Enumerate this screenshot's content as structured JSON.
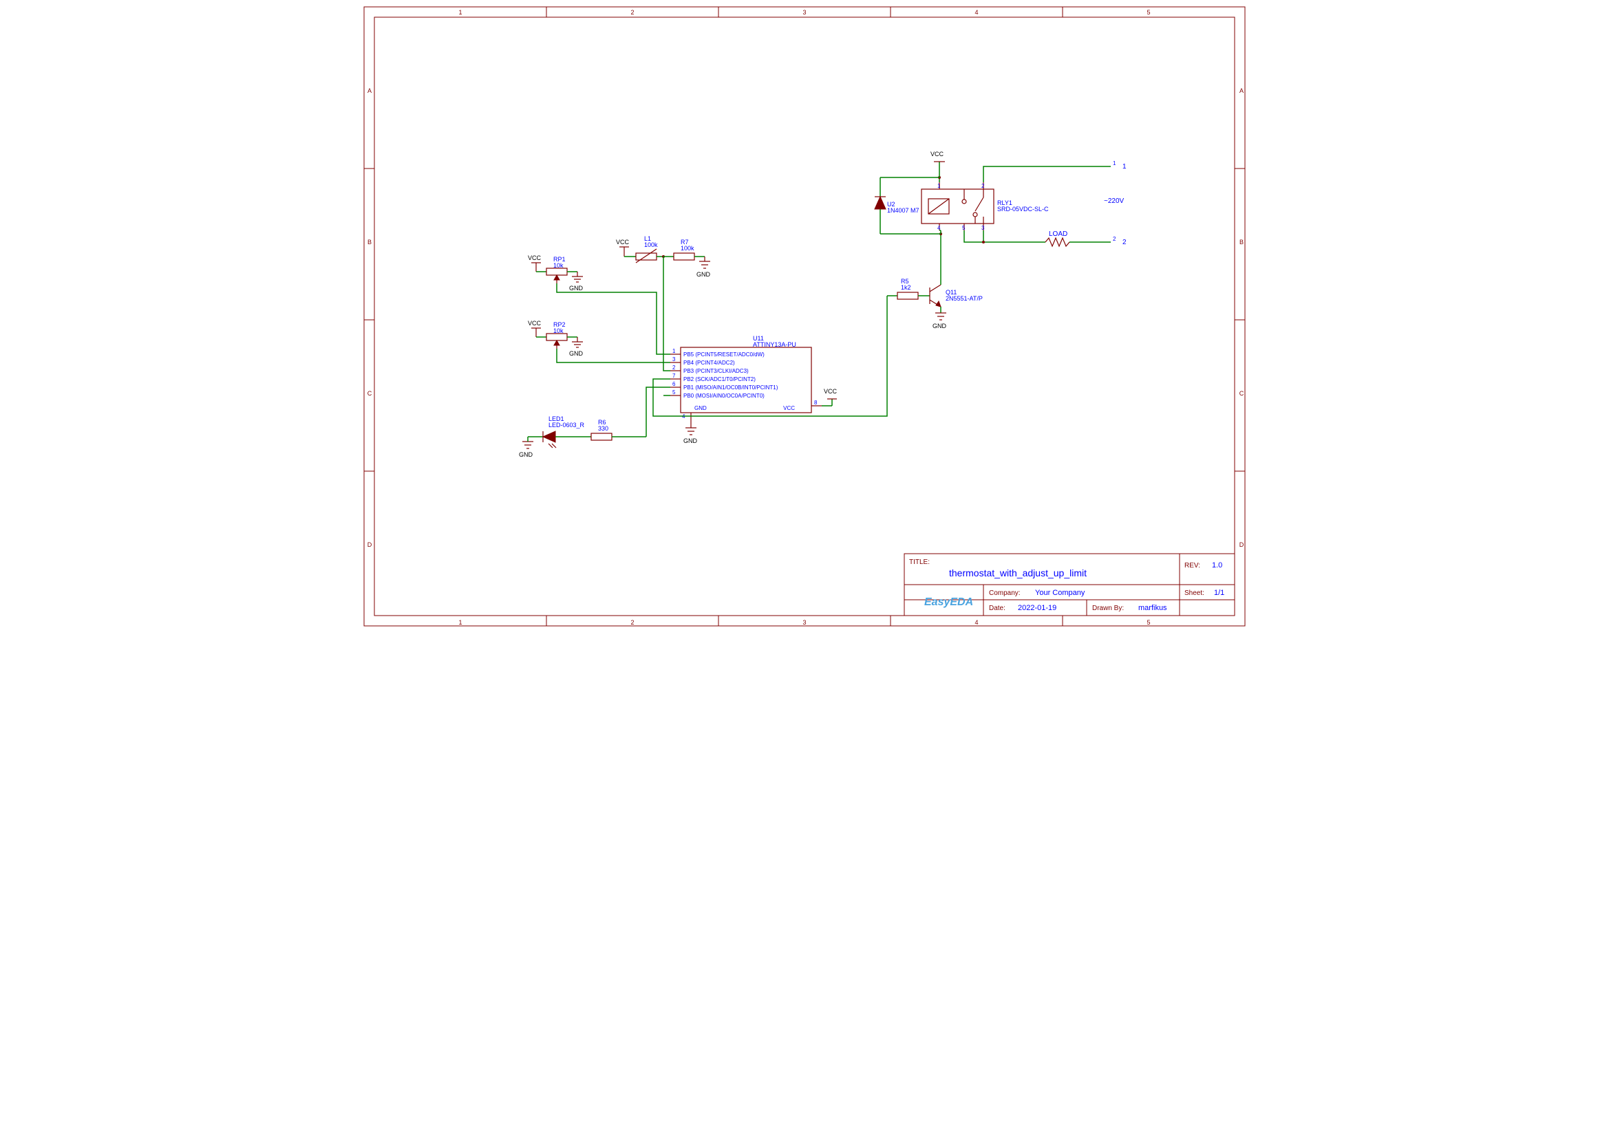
{
  "frame": {
    "cols": [
      "1",
      "2",
      "3",
      "4",
      "5"
    ],
    "rows": [
      "A",
      "B",
      "C",
      "D"
    ]
  },
  "titleblock": {
    "title_lbl": "TITLE:",
    "title": "thermostat_with_adjust_up_limit",
    "rev_lbl": "REV:",
    "rev": "1.0",
    "company_lbl": "Company:",
    "company": "Your Company",
    "sheet_lbl": "Sheet:",
    "sheet": "1/1",
    "date_lbl": "Date:",
    "date": "2022-01-19",
    "drawn_lbl": "Drawn By:",
    "drawn": "marfikus",
    "logo": "EasyEDA"
  },
  "power": {
    "vcc": "VCC",
    "gnd": "GND"
  },
  "annot": {
    "mains": "~220V",
    "load": "LOAD"
  },
  "conn": {
    "p1_pin": "1",
    "p1_lbl": "1",
    "p2_pin": "2",
    "p2_lbl": "2"
  },
  "rp1": {
    "ref": "RP1",
    "val": "10k"
  },
  "rp2": {
    "ref": "RP2",
    "val": "10k"
  },
  "l1": {
    "ref": "L1",
    "val": "100k"
  },
  "r7": {
    "ref": "R7",
    "val": "100k"
  },
  "r5": {
    "ref": "R5",
    "val": "1k2"
  },
  "r6": {
    "ref": "R6",
    "val": "330"
  },
  "led1": {
    "ref": "LED1",
    "val": "LED-0603_R"
  },
  "u2": {
    "ref": "U2",
    "val": "1N4007 M7"
  },
  "q11": {
    "ref": "Q11",
    "val": "2N5551-AT/P"
  },
  "rly1": {
    "ref": "RLY1",
    "val": "SRD-05VDC-SL-C",
    "pin1": "1",
    "pin2": "2",
    "pin3": "3",
    "pin4": "4",
    "pin5": "5"
  },
  "u11": {
    "ref": "U11",
    "val": "ATTINY13A-PU",
    "pins": {
      "p1": "1",
      "p1l": "PB5 (PCINT5/RESET/ADC0/dW)",
      "p3": "3",
      "p3l": "PB4 (PCINT4/ADC2)",
      "p2": "2",
      "p2l": "PB3 (PCINT3/CLKI/ADC3)",
      "p7": "7",
      "p7l": "PB2 (SCK/ADC1/T0/PCINT2)",
      "p6": "6",
      "p6l": "PB1 (MISO/AIN1/OC0B/INT0/PCINT1)",
      "p5": "5",
      "p5l": "PB0 (MOSI/AIN0/OC0A/PCINT0)",
      "p4": "4",
      "p4l": "GND",
      "p8": "8",
      "p8l": "VCC"
    }
  }
}
